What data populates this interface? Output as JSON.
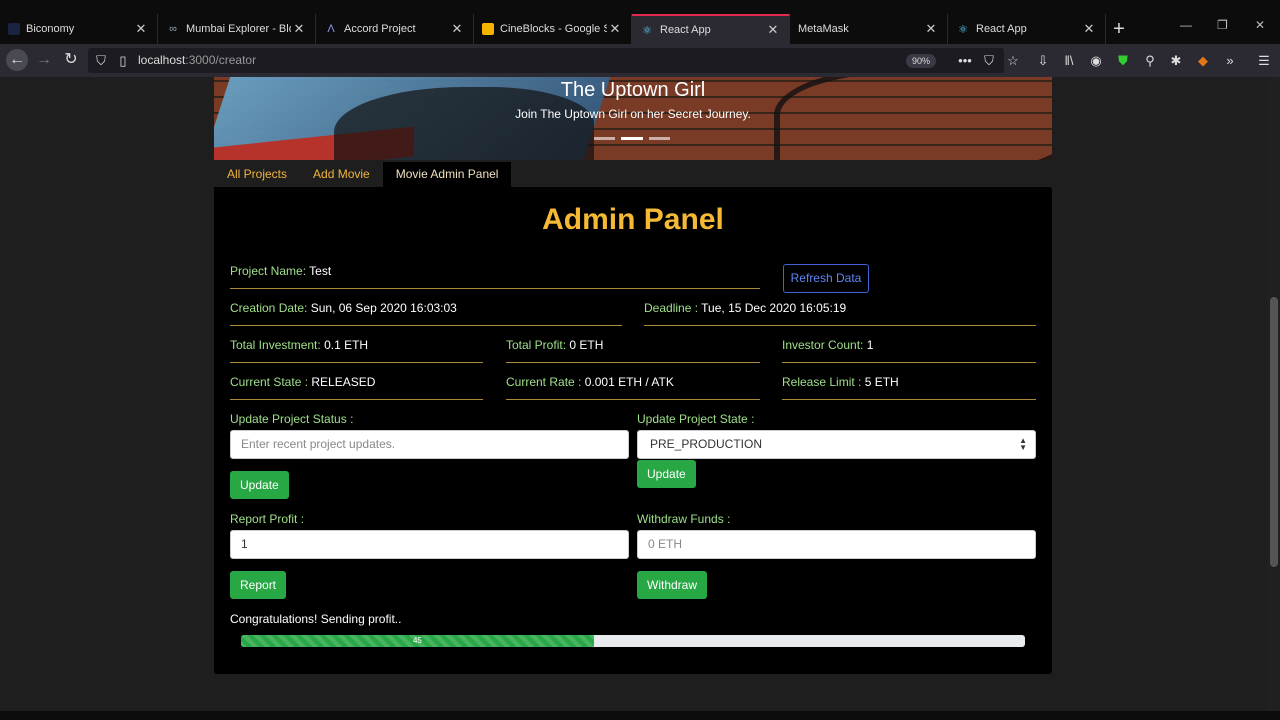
{
  "browser": {
    "tabs": [
      {
        "title": "Biconomy",
        "icon": "biconomy-icon",
        "active": false
      },
      {
        "title": "Mumbai Explorer - Bloc",
        "icon": "polygon-icon",
        "active": false
      },
      {
        "title": "Accord Project",
        "icon": "accord-icon",
        "active": false
      },
      {
        "title": "CineBlocks - Google Slid",
        "icon": "google-slides-icon",
        "active": false
      },
      {
        "title": "React App",
        "icon": "react-icon",
        "active": true
      },
      {
        "title": "MetaMask",
        "icon": "",
        "active": false
      },
      {
        "title": "React App",
        "icon": "react-icon",
        "active": false
      }
    ],
    "url_host": "localhost",
    "url_path": ":3000/creator",
    "zoom": "90%"
  },
  "banner": {
    "title": "The Uptown Girl",
    "subtitle": "Join The Uptown Girl on her Secret Journey."
  },
  "nav": {
    "items": [
      "All Projects",
      "Add Movie",
      "Movie Admin Panel"
    ],
    "active_index": 2
  },
  "panel": {
    "title": "Admin Panel",
    "refresh_label": "Refresh Data",
    "project_name": {
      "label": "Project Name:",
      "value": "Test"
    },
    "creation_date": {
      "label": "Creation Date:",
      "value": "Sun, 06 Sep 2020 16:03:03"
    },
    "deadline": {
      "label": "Deadline :",
      "value": "Tue, 15 Dec 2020 16:05:19"
    },
    "total_investment": {
      "label": "Total Investment:",
      "value": "0.1 ETH"
    },
    "total_profit": {
      "label": "Total Profit:",
      "value": "0 ETH"
    },
    "investor_count": {
      "label": "Investor Count:",
      "value": "1"
    },
    "current_state": {
      "label": "Current State :",
      "value": "RELEASED"
    },
    "current_rate": {
      "label": "Current Rate :",
      "value": "0.001 ETH / ATK"
    },
    "release_limit": {
      "label": "Release Limit :",
      "value": "5 ETH"
    },
    "update_status": {
      "label": "Update Project Status :",
      "placeholder": "Enter recent project updates.",
      "button": "Update"
    },
    "update_state": {
      "label": "Update Project State :",
      "selected": "PRE_PRODUCTION",
      "button": "Update"
    },
    "report_profit": {
      "label": "Report Profit :",
      "value": "1",
      "button": "Report"
    },
    "withdraw": {
      "label": "Withdraw Funds :",
      "placeholder": "0 ETH",
      "button": "Withdraw"
    },
    "message": "Congratulations! Sending profit..",
    "progress": {
      "value": 45,
      "label": "45"
    }
  }
}
